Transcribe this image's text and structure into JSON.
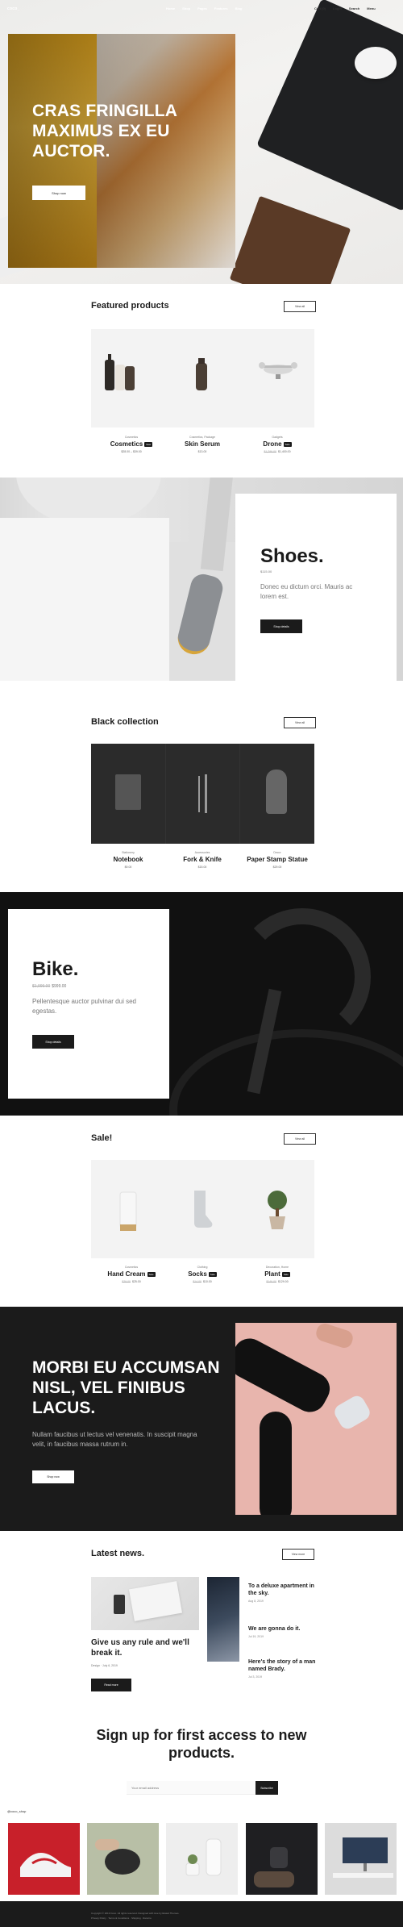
{
  "header": {
    "logo": "coco_",
    "nav": [
      "Home",
      "Shop",
      "Pages",
      "Features",
      "Blog"
    ],
    "right": [
      "Cart (0)",
      "Login",
      "Search",
      "Menu"
    ]
  },
  "hero": {
    "title": "CRAS FRINGILLA MAXIMUS EX EU AUCTOR.",
    "button": "Shop now"
  },
  "featured": {
    "title": "Featured products",
    "button": "View all",
    "products": [
      {
        "category": "Cosmetics",
        "name": "Cosmetics",
        "badge": "New",
        "price": "$28.00 – $39.00"
      },
      {
        "category": "Cosmetics, Package",
        "name": "Skin Serum",
        "badge": "",
        "price": "$13.00"
      },
      {
        "category": "Gadgets",
        "name": "Drone",
        "badge": "Sale",
        "old_price": "$1,799.00",
        "price": "$1,400.00"
      }
    ]
  },
  "shoes": {
    "title": "Shoes.",
    "price": "$115.00",
    "desc": "Donec eu dictum orci. Mauris ac lorem est.",
    "button": "Shop details"
  },
  "black": {
    "title": "Black collection",
    "button": "View all",
    "products": [
      {
        "category": "Stationery",
        "name": "Notebook",
        "price": "$9.00"
      },
      {
        "category": "Accessories",
        "name": "Fork & Knife",
        "price": "$15.00"
      },
      {
        "category": "Decor",
        "name": "Paper Stamp Statue",
        "price": "$29.00"
      }
    ]
  },
  "bike": {
    "title": "Bike.",
    "old_price": "$1,999.00",
    "price": "$999.00",
    "desc": "Pellentesque auctor pulvinar dui sed egestas.",
    "button": "Shop details"
  },
  "sale": {
    "title": "Sale!",
    "button": "View all",
    "products": [
      {
        "category": "Cosmetics",
        "name": "Hand Cream",
        "badge": "Sale",
        "old_price": "$29.00",
        "price": "$25.00"
      },
      {
        "category": "Clothing",
        "name": "Socks",
        "badge": "Sale",
        "old_price": "$14.00",
        "price": "$10.00"
      },
      {
        "category": "Decoration, Home",
        "name": "Plant",
        "badge": "Sale",
        "old_price": "$149.00",
        "price": "$129.00"
      }
    ]
  },
  "cta": {
    "title": "MORBI EU ACCUMSAN NISL, VEL FINIBUS LACUS.",
    "desc": "Nullam faucibus ut lectus vel venenatis. In suscipit magna velit, in faucibus massa rutrum in.",
    "button": "Shop now"
  },
  "news": {
    "title": "Latest news.",
    "button": "View more",
    "featured": {
      "title": "Give us any rule and we'll break it.",
      "meta": "Design  ·  July 6, 2019",
      "button": "Read more"
    },
    "items": [
      {
        "title": "To a deluxe apartment in the sky.",
        "date": "Aug 8, 2019"
      },
      {
        "title": "We are gonna do it.",
        "date": "Jul 19, 2019"
      },
      {
        "title": "Here's the story of a man named Brady.",
        "date": "Jul 3, 2019"
      }
    ]
  },
  "signup": {
    "title": "Sign up for first access to new products.",
    "placeholder": "Your email address",
    "button": "Subscribe"
  },
  "instagram": {
    "handle": "@coco_shop"
  },
  "footer": {
    "line1": "Copyright © 2019 Coco. All rights reserved. Designed with love by Elated Themes.",
    "line2": "Privacy Policy · Terms & Conditions · Shipping · Returns"
  }
}
